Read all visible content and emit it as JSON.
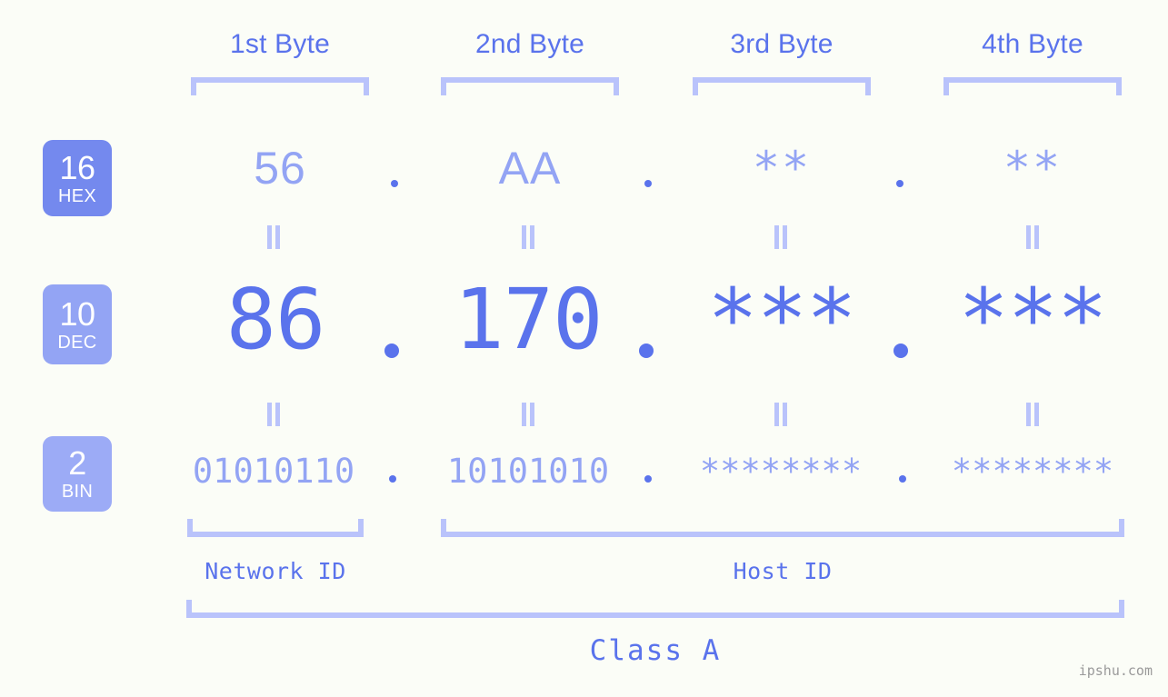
{
  "background_color": "#fbfdf7",
  "accent_strong": "#5a73ec",
  "accent_light": "#93a4f4",
  "accent_pale": "#b9c3fb",
  "byte_headers": [
    {
      "label": "1st Byte"
    },
    {
      "label": "2nd Byte"
    },
    {
      "label": "3rd Byte"
    },
    {
      "label": "4th Byte"
    }
  ],
  "bases": [
    {
      "number": "16",
      "name": "HEX",
      "color": "#7489ee"
    },
    {
      "number": "10",
      "name": "DEC",
      "color": "#93a4f4"
    },
    {
      "number": "2",
      "name": "BIN",
      "color": "#9cabf6"
    }
  ],
  "rows": {
    "hex": {
      "values": [
        "56",
        "AA",
        "**",
        "**"
      ]
    },
    "dec": {
      "values": [
        "86",
        "170",
        "***",
        "***"
      ]
    },
    "bin": {
      "values": [
        "01010110",
        "10101010",
        "********",
        "********"
      ]
    }
  },
  "separators": {
    "hex": [
      ".",
      ".",
      "."
    ],
    "dec": [
      ".",
      ".",
      "."
    ],
    "bin": [
      ".",
      ".",
      "."
    ]
  },
  "equality_marks": {
    "symbol": "=",
    "count_per_row": 4,
    "rows": 2
  },
  "footer": {
    "network_id_label": "Network ID",
    "host_id_label": "Host ID",
    "class_label": "Class A"
  },
  "watermark": {
    "text": "ipshu.com"
  }
}
